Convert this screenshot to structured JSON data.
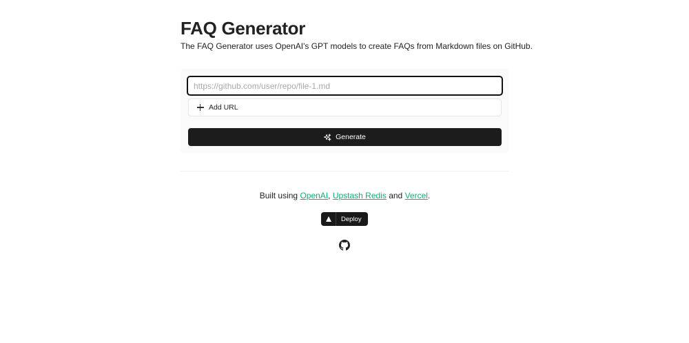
{
  "header": {
    "title": "FAQ Generator",
    "description": "The FAQ Generator uses OpenAI's GPT models to create FAQs from Markdown files on GitHub."
  },
  "form": {
    "url_input": {
      "value": "",
      "placeholder": "https://github.com/user/repo/file-1.md"
    },
    "add_url_label": "Add URL",
    "generate_label": "Generate"
  },
  "footer": {
    "built_prefix": "Built using ",
    "openai_link": "OpenAI",
    "sep1": ", ",
    "upstash_link": "Upstash Redis",
    "sep2": " and ",
    "vercel_link": "Vercel",
    "suffix": ".",
    "deploy_label": "Deploy",
    "link_color": "#1aa874"
  },
  "icons": {
    "add": "plus-icon",
    "generate": "sparkles-icon",
    "deploy": "vercel-triangle-icon",
    "repo": "github-icon"
  }
}
